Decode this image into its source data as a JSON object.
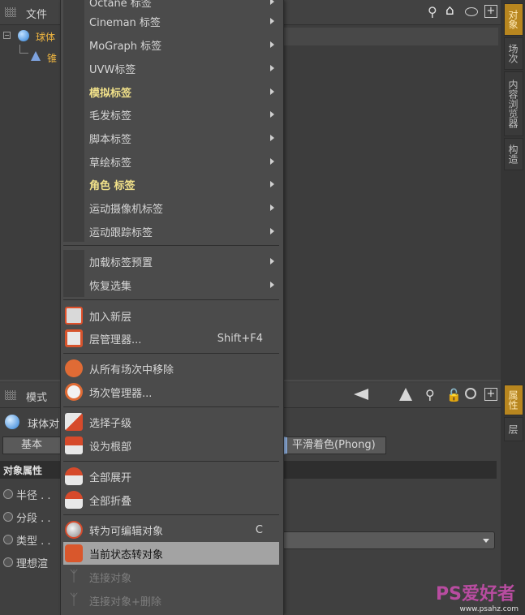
{
  "top_panel": {
    "file_menu": "文件",
    "tree": [
      {
        "label": "球体"
      },
      {
        "label": "锥"
      }
    ]
  },
  "right_tabs": [
    "对象",
    "场次",
    "内容浏览器",
    "构造"
  ],
  "right_tabs_bottom": [
    "属性",
    "层"
  ],
  "bottom_panel": {
    "mode_menu": "模式",
    "object_title": "球体对",
    "tab_basic": "基本",
    "tab_phong": "平滑着色(Phong)",
    "section_header": "对象属性",
    "props": [
      {
        "label": "半径 . ."
      },
      {
        "label": "分段 . ."
      },
      {
        "label": "类型 . ."
      },
      {
        "label": "理想渲"
      }
    ]
  },
  "context_menu": {
    "items": [
      {
        "label": "Octane 标签",
        "submenu": true
      },
      {
        "label": "Cineman 标签",
        "submenu": true
      },
      {
        "label": "MoGraph 标签",
        "submenu": true
      },
      {
        "label": "UVW标签",
        "submenu": true
      },
      {
        "label": "模拟标签",
        "submenu": true,
        "highlight": true
      },
      {
        "label": "毛发标签",
        "submenu": true
      },
      {
        "label": "脚本标签",
        "submenu": true
      },
      {
        "label": "草绘标签",
        "submenu": true
      },
      {
        "label": "角色 标签",
        "submenu": true,
        "highlight": true
      },
      {
        "label": "运动摄像机标签",
        "submenu": true
      },
      {
        "label": "运动跟踪标签",
        "submenu": true
      },
      {
        "label": "加载标签预置",
        "submenu": true
      },
      {
        "label": "恢复选集",
        "submenu": true
      },
      {
        "label": "加入新层",
        "icon": "new-layer-icon"
      },
      {
        "label": "层管理器...",
        "icon": "layer-manager-icon",
        "shortcut": "Shift+F4"
      },
      {
        "label": "从所有场次中移除",
        "icon": "remove-take-icon"
      },
      {
        "label": "场次管理器...",
        "icon": "take-manager-icon"
      },
      {
        "label": "选择子级",
        "icon": "select-children-icon"
      },
      {
        "label": "设为根部",
        "icon": "set-root-icon"
      },
      {
        "label": "全部展开",
        "icon": "expand-all-icon"
      },
      {
        "label": "全部折叠",
        "icon": "collapse-all-icon"
      },
      {
        "label": "转为可编辑对象",
        "icon": "make-editable-icon",
        "shortcut": "C"
      },
      {
        "label": "当前状态转对象",
        "icon": "current-state-icon",
        "active": true
      },
      {
        "label": "连接对象",
        "icon": "connect-objects-icon",
        "disabled": true
      },
      {
        "label": "连接对象+删除",
        "icon": "connect-delete-icon",
        "disabled": true
      }
    ]
  },
  "watermark": {
    "text": "PS爱好者",
    "url_text": "www.psahz.com"
  }
}
